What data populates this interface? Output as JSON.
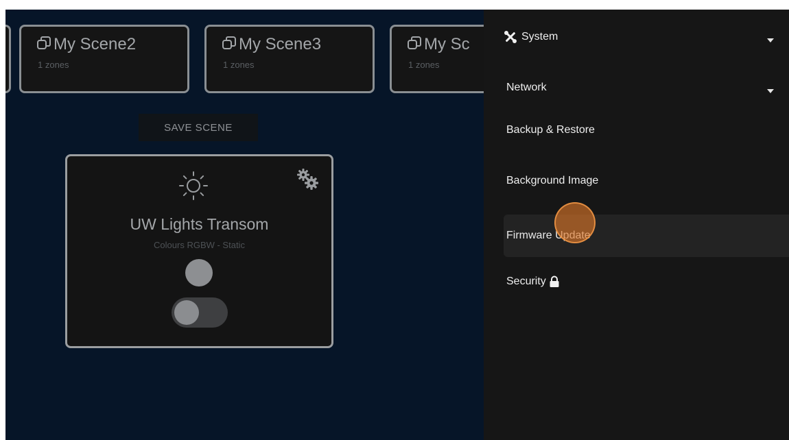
{
  "scenes": [
    {
      "title": "My Scene2",
      "subtitle": "1 zones"
    },
    {
      "title": "My Scene3",
      "subtitle": "1 zones"
    },
    {
      "title": "My Sc",
      "subtitle": "1 zones"
    }
  ],
  "save_scene_label": "SAVE SCENE",
  "zone": {
    "icon": "sun-icon",
    "name": "UW Lights Transom",
    "subtitle": "Colours RGBW - Static",
    "toggle_on": false
  },
  "menu": {
    "system": {
      "label": "System",
      "icon": "tools-icon"
    },
    "network": {
      "label": "Network"
    },
    "backup": {
      "label": "Backup & Restore"
    },
    "background": {
      "label": "Background Image"
    },
    "firmware": {
      "label": "Firmware Update"
    },
    "security": {
      "label": "Security",
      "icon": "lock-icon"
    }
  },
  "colors": {
    "main_background": "#061528",
    "panel_background": "#161616",
    "highlight": "#232323",
    "cursor": "#de7828"
  }
}
